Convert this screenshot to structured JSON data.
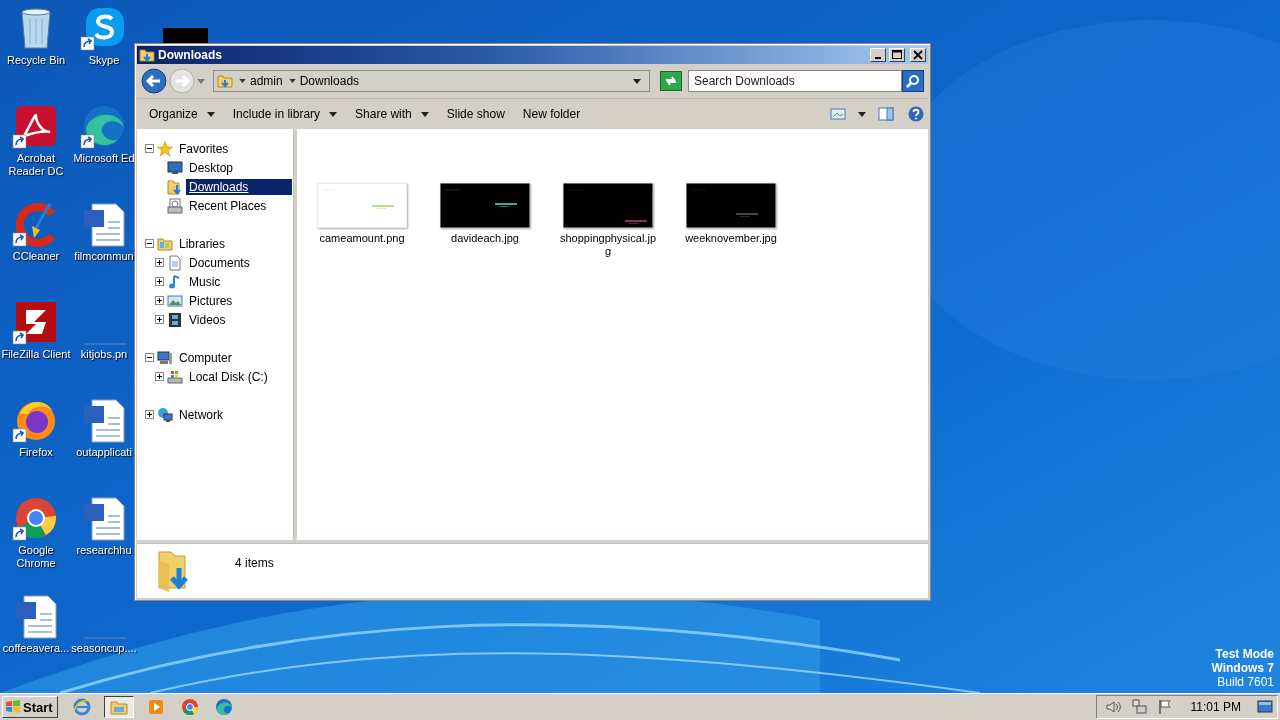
{
  "desktop": {
    "icons": [
      {
        "label": "Recycle Bin",
        "kind": "recycle",
        "shortcut": false
      },
      {
        "label": "Acrobat Reader DC",
        "kind": "acrobat",
        "shortcut": true
      },
      {
        "label": "CCleaner",
        "kind": "ccleaner",
        "shortcut": true
      },
      {
        "label": "FileZilla Client",
        "kind": "filezilla",
        "shortcut": true
      },
      {
        "label": "Firefox",
        "kind": "firefox",
        "shortcut": true
      },
      {
        "label": "Google Chrome",
        "kind": "chrome",
        "shortcut": true
      },
      {
        "label": "coffeeavera...",
        "kind": "word",
        "shortcut": false
      },
      {
        "label": "Skype",
        "kind": "skype",
        "shortcut": true
      },
      {
        "label": "Microsoft Ed",
        "kind": "edge",
        "shortcut": true
      },
      {
        "label": "filmcommun",
        "kind": "word",
        "shortcut": false
      },
      {
        "label": "kitjobs.pn",
        "kind": "blank",
        "shortcut": false
      },
      {
        "label": "outapplicati",
        "kind": "word",
        "shortcut": false
      },
      {
        "label": "researchhu",
        "kind": "word",
        "shortcut": false
      },
      {
        "label": "seasoncup....",
        "kind": "blank",
        "shortcut": false
      }
    ],
    "os_info": [
      "Test Mode",
      "Windows 7",
      "Build 7601"
    ]
  },
  "window": {
    "title": "Downloads",
    "address": {
      "segments": [
        "admin",
        "Downloads"
      ]
    },
    "search": {
      "placeholder": "Search Downloads"
    },
    "toolbar": [
      {
        "label": "Organize",
        "dropdown": true
      },
      {
        "label": "Include in library",
        "dropdown": true
      },
      {
        "label": "Share with",
        "dropdown": true
      },
      {
        "label": "Slide show",
        "dropdown": false
      },
      {
        "label": "New folder",
        "dropdown": false
      }
    ],
    "nav": [
      {
        "label": "Favorites",
        "kind": "star",
        "expanded": true,
        "selected": false,
        "children": [
          {
            "label": "Desktop",
            "kind": "desktop",
            "selected": false
          },
          {
            "label": "Downloads",
            "kind": "download-folder",
            "selected": true
          },
          {
            "label": "Recent Places",
            "kind": "recent",
            "selected": false
          }
        ]
      },
      {
        "label": "Libraries",
        "kind": "library",
        "expanded": true,
        "selected": false,
        "children": [
          {
            "label": "Documents",
            "kind": "document",
            "expanded": false,
            "selected": false
          },
          {
            "label": "Music",
            "kind": "music",
            "expanded": false,
            "selected": false
          },
          {
            "label": "Pictures",
            "kind": "pictures",
            "expanded": false,
            "selected": false
          },
          {
            "label": "Videos",
            "kind": "videos",
            "expanded": false,
            "selected": false
          }
        ]
      },
      {
        "label": "Computer",
        "kind": "computer",
        "expanded": true,
        "selected": false,
        "children": [
          {
            "label": "Local Disk (C:)",
            "kind": "disk",
            "expanded": false,
            "selected": false
          }
        ]
      },
      {
        "label": "Network",
        "kind": "network",
        "expanded": false,
        "selected": false
      }
    ],
    "files": [
      {
        "name": "cameamount.png"
      },
      {
        "name": "davideach.jpg"
      },
      {
        "name": "shoppingphysical.jpg"
      },
      {
        "name": "weeknovember.jpg"
      }
    ],
    "status": {
      "count": "4 items"
    }
  },
  "taskbar": {
    "start": "Start",
    "apps": [
      {
        "kind": "ie",
        "selected": false
      },
      {
        "kind": "explorer",
        "selected": true
      },
      {
        "kind": "media",
        "selected": false
      },
      {
        "kind": "chrome",
        "selected": false
      },
      {
        "kind": "edge",
        "selected": false
      }
    ],
    "clock": "11:01 PM"
  }
}
